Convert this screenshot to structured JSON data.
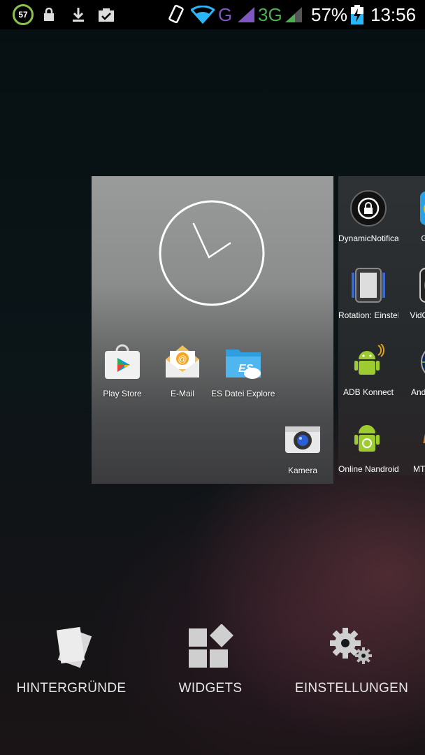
{
  "status_bar": {
    "notification_count": "57",
    "network_g": "G",
    "network_3g": "3G",
    "battery": "57%",
    "time": "13:56"
  },
  "main_screen": {
    "apps": [
      {
        "label": "Play Store"
      },
      {
        "label": "E-Mail"
      },
      {
        "label": "ES Datei Explorer"
      },
      {
        "label": "Kamera"
      }
    ]
  },
  "right_screen": {
    "apps": [
      {
        "label": "DynamicNotifications"
      },
      {
        "label": "G C"
      },
      {
        "label": "Rotation: Einstellungen"
      },
      {
        "label": "VidOn.me"
      },
      {
        "label": "ADB Konnect"
      },
      {
        "label": "AndroiTS"
      },
      {
        "label": "Online Nandroid"
      },
      {
        "label": "MTK Co"
      }
    ]
  },
  "bottom_options": {
    "wallpapers": "HINTERGRÜNDE",
    "widgets": "WIDGETS",
    "settings": "EINSTELLUNGEN"
  },
  "colors": {
    "wifi": "#29b6f6",
    "g_network": "#7e57c2",
    "g3_network": "#4caf50",
    "battery": "#29b6f6",
    "notif_ring": "#8bc34a"
  }
}
